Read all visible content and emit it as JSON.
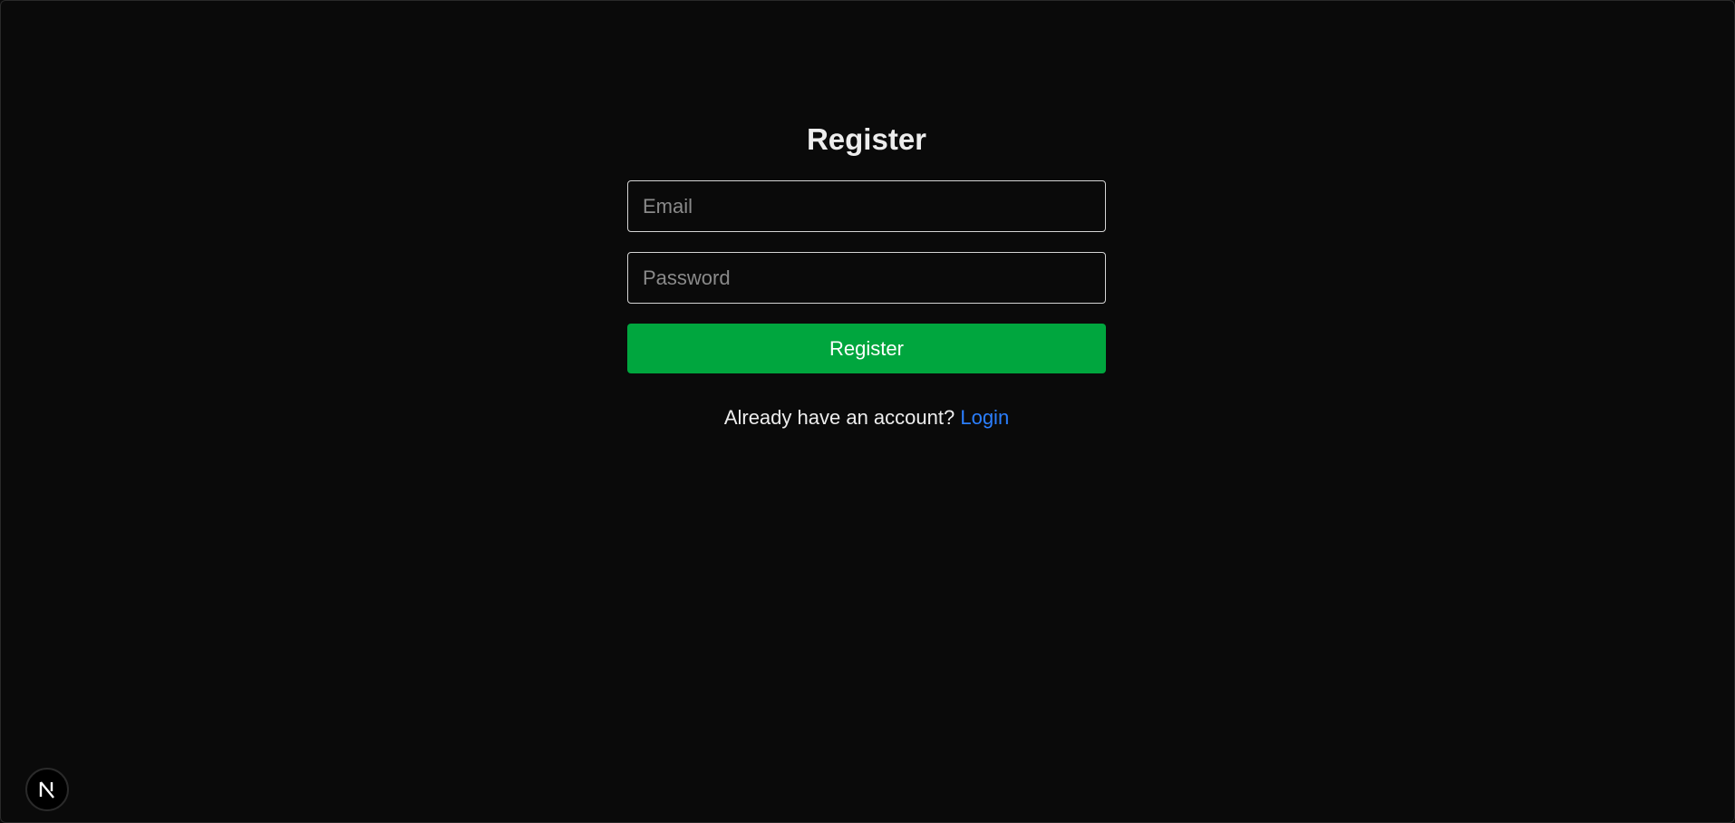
{
  "page": {
    "title": "Register"
  },
  "form": {
    "email_placeholder": "Email",
    "email_value": "",
    "password_placeholder": "Password",
    "password_value": "",
    "submit_label": "Register"
  },
  "footer": {
    "prompt": "Already have an account?",
    "login_link": "Login"
  },
  "dev_badge": {
    "icon": "nextjs-logo-icon",
    "letter": "N"
  },
  "colors": {
    "background": "#0a0a0a",
    "text": "#ededed",
    "button": "#00a63e",
    "link": "#2b7fff",
    "input_border": "#d4d4d4"
  }
}
